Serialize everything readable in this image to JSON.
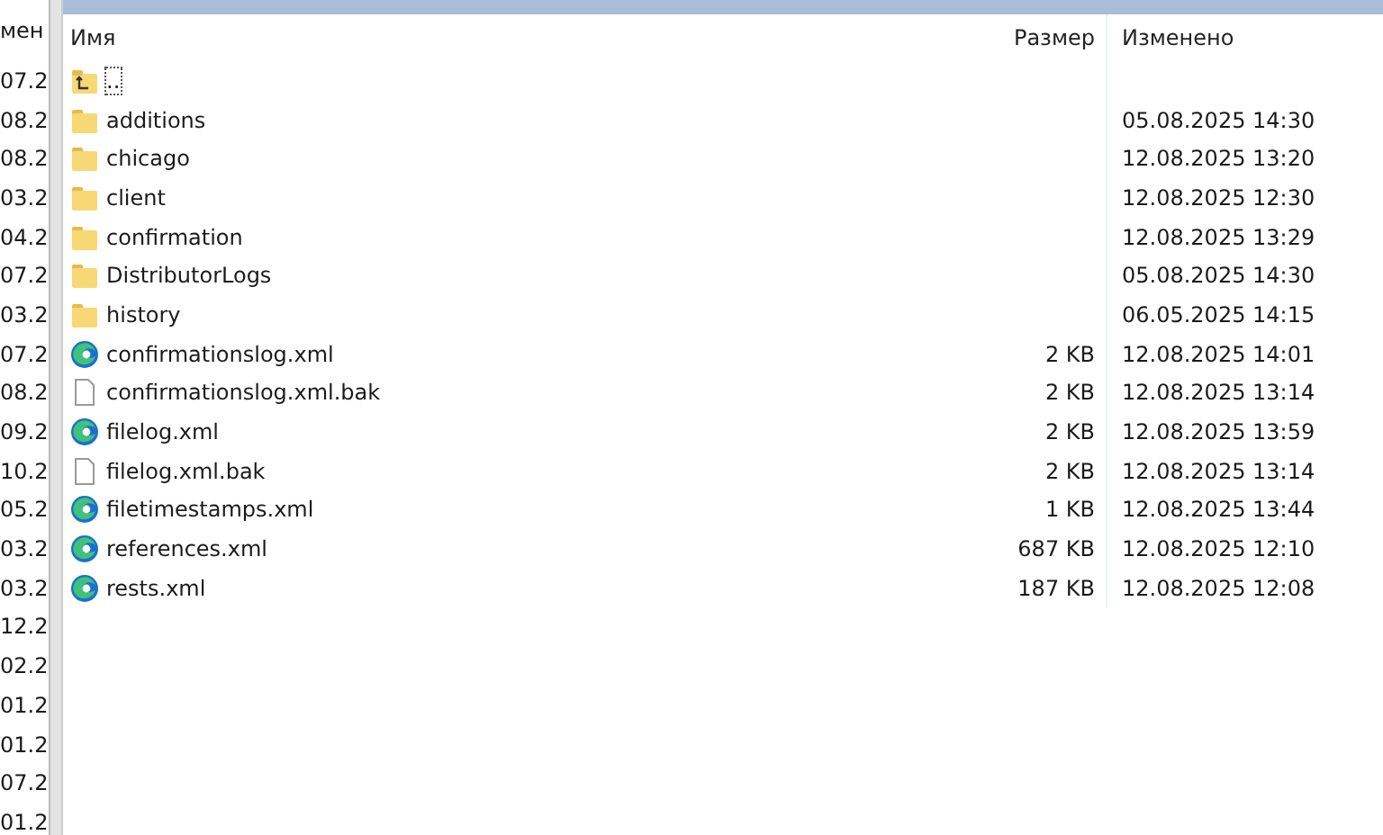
{
  "left_pane": {
    "header": "мен",
    "rows": [
      "07.2",
      "08.2",
      "08.2",
      "03.2",
      "04.2",
      "07.2",
      "03.2",
      "07.2",
      "08.2",
      "09.2",
      "10.2",
      "05.2",
      "03.2",
      "03.2",
      "12.2",
      "02.2",
      "01.2",
      "01.2",
      "07.2",
      "01.2"
    ]
  },
  "file_list": {
    "columns": [
      "Имя",
      "Размер",
      "Изменено"
    ],
    "rows": [
      {
        "kind": "parent",
        "name": "..",
        "size": "",
        "modified": ""
      },
      {
        "kind": "folder",
        "name": "additions",
        "size": "",
        "modified": "05.08.2025 14:30"
      },
      {
        "kind": "folder",
        "name": "chicago",
        "size": "",
        "modified": "12.08.2025 13:20"
      },
      {
        "kind": "folder",
        "name": "client",
        "size": "",
        "modified": "12.08.2025 12:30"
      },
      {
        "kind": "folder",
        "name": "confirmation",
        "size": "",
        "modified": "12.08.2025 13:29"
      },
      {
        "kind": "folder",
        "name": "DistributorLogs",
        "size": "",
        "modified": "05.08.2025 14:30"
      },
      {
        "kind": "folder",
        "name": "history",
        "size": "",
        "modified": "06.05.2025 14:15"
      },
      {
        "kind": "xml",
        "name": "confirmationslog.xml",
        "size": "2 KB",
        "modified": "12.08.2025 14:01"
      },
      {
        "kind": "file",
        "name": "confirmationslog.xml.bak",
        "size": "2 KB",
        "modified": "12.08.2025 13:14"
      },
      {
        "kind": "xml",
        "name": "filelog.xml",
        "size": "2 KB",
        "modified": "12.08.2025 13:59"
      },
      {
        "kind": "file",
        "name": "filelog.xml.bak",
        "size": "2 KB",
        "modified": "12.08.2025 13:14"
      },
      {
        "kind": "xml",
        "name": "filetimestamps.xml",
        "size": "1 KB",
        "modified": "12.08.2025 13:44"
      },
      {
        "kind": "xml",
        "name": "references.xml",
        "size": "687 KB",
        "modified": "12.08.2025 12:10"
      },
      {
        "kind": "xml",
        "name": "rests.xml",
        "size": "187 KB",
        "modified": "12.08.2025 12:08"
      }
    ]
  }
}
